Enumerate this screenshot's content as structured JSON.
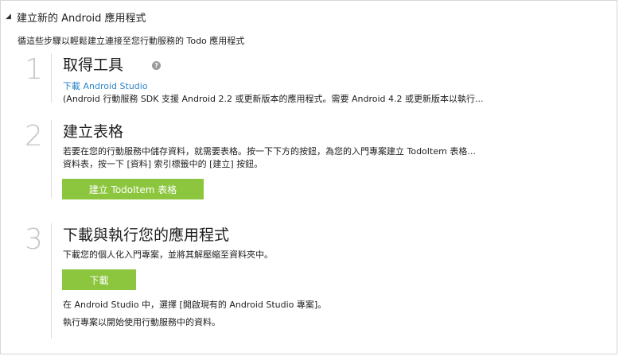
{
  "section": {
    "title": "建立新的 Android 應用程式",
    "intro": "循這些步驟以輕鬆建立連接至您行動服務的 Todo 應用程式"
  },
  "steps": [
    {
      "number": "1",
      "title": "取得工具",
      "link": "下載 Android Studio",
      "desc": "(Android 行動服務 SDK 支援 Android 2.2 或更新版本的應用程式。需要 Android 4.2 或更新版本以執行..."
    },
    {
      "number": "2",
      "title": "建立表格",
      "desc1": "若要在您的行動服務中儲存資料，就需要表格。按一下下方的按鈕，為您的入門專案建立 TodoItem 表格...",
      "desc2": "資料表，按一下 [資料] 索引標籤中的 [建立] 按鈕。",
      "button": "建立 TodoItem 表格"
    },
    {
      "number": "3",
      "title": "下載與執行您的應用程式",
      "desc1": "下載您的個人化入門專案，並將其解壓縮至資料夾中。",
      "button": "下載",
      "desc2": "在 Android Studio 中，選擇 [開啟現有的 Android Studio 專案]。",
      "desc3": "執行專案以開始使用行動服務中的資料。"
    }
  ],
  "colors": {
    "accent_button": "#8cc63f",
    "link": "#2e86c8"
  },
  "icons": {
    "caret": "collapse-caret-icon",
    "help": "help-icon"
  }
}
